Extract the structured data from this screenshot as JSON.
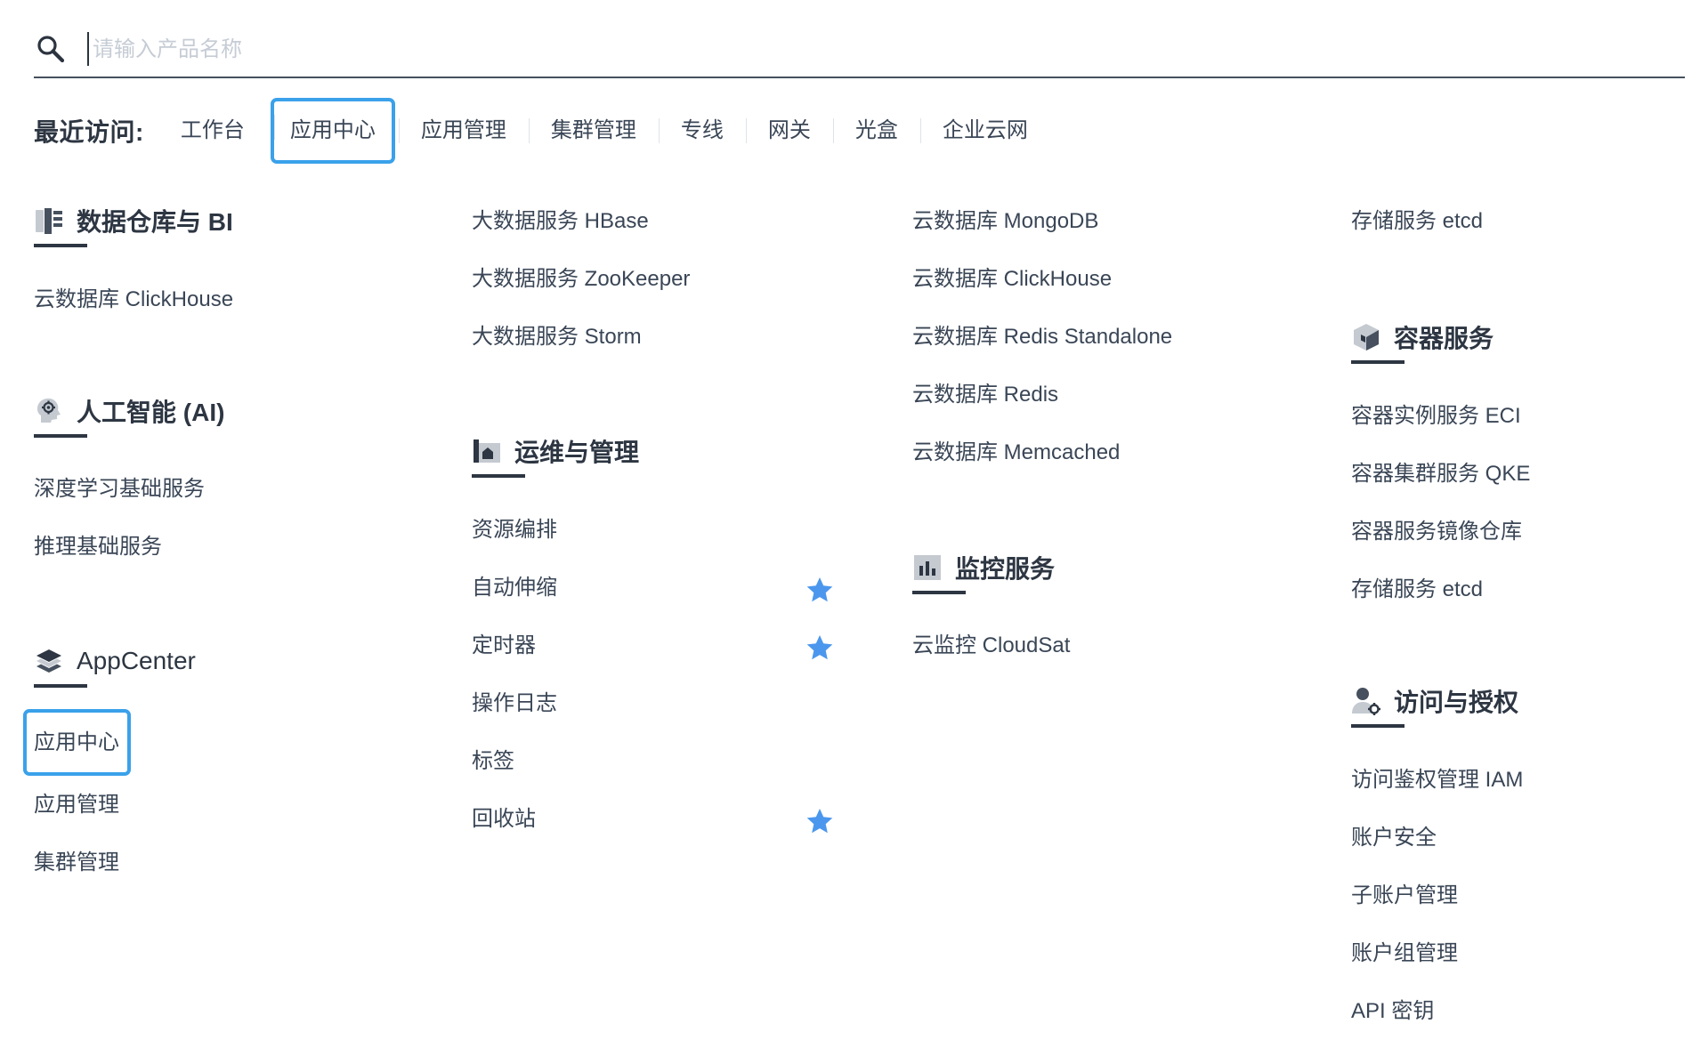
{
  "search": {
    "placeholder": "请输入产品名称",
    "value": ""
  },
  "recent": {
    "label": "最近访问:",
    "items": [
      "工作台",
      "应用中心",
      "应用管理",
      "集群管理",
      "专线",
      "网关",
      "光盒",
      "企业云网"
    ],
    "active": "应用中心"
  },
  "accent_color": "#3aa1ea",
  "star_color": "#4b97ee",
  "columns": {
    "col1": {
      "dw": {
        "title": "数据仓库与 BI",
        "icon": "database-icon",
        "items": [
          "云数据库 ClickHouse"
        ]
      },
      "ai": {
        "title": "人工智能 (AI)",
        "icon": "ai-head-icon",
        "items": [
          "深度学习基础服务",
          "推理基础服务"
        ]
      },
      "appcenter": {
        "title": "AppCenter",
        "icon": "layers-icon",
        "items": [
          "应用中心",
          "应用管理",
          "集群管理"
        ],
        "active": "应用中心"
      }
    },
    "col2": {
      "bigdata": {
        "items": [
          "大数据服务 HBase",
          "大数据服务 ZooKeeper",
          "大数据服务 Storm"
        ]
      },
      "ops": {
        "title": "运维与管理",
        "icon": "ops-icon",
        "items": [
          "资源编排",
          "自动伸缩",
          "定时器",
          "操作日志",
          "标签",
          "回收站"
        ],
        "starred": [
          "自动伸缩",
          "定时器",
          "回收站"
        ]
      }
    },
    "col3": {
      "db": {
        "items": [
          "云数据库 MongoDB",
          "云数据库 ClickHouse",
          "云数据库 Redis Standalone",
          "云数据库 Redis",
          "云数据库 Memcached"
        ]
      },
      "monitor": {
        "title": "监控服务",
        "icon": "bar-chart-icon",
        "items": [
          "云监控 CloudSat"
        ]
      }
    },
    "col4": {
      "storage": {
        "items": [
          "存储服务 etcd"
        ]
      },
      "container": {
        "title": "容器服务",
        "icon": "container-cube-icon",
        "items": [
          "容器实例服务 ECI",
          "容器集群服务 QKE",
          "容器服务镜像仓库",
          "存储服务 etcd"
        ]
      },
      "iam": {
        "title": "访问与授权",
        "icon": "user-gear-icon",
        "items": [
          "访问鉴权管理 IAM",
          "账户安全",
          "子账户管理",
          "账户组管理",
          "API 密钥"
        ]
      }
    }
  }
}
